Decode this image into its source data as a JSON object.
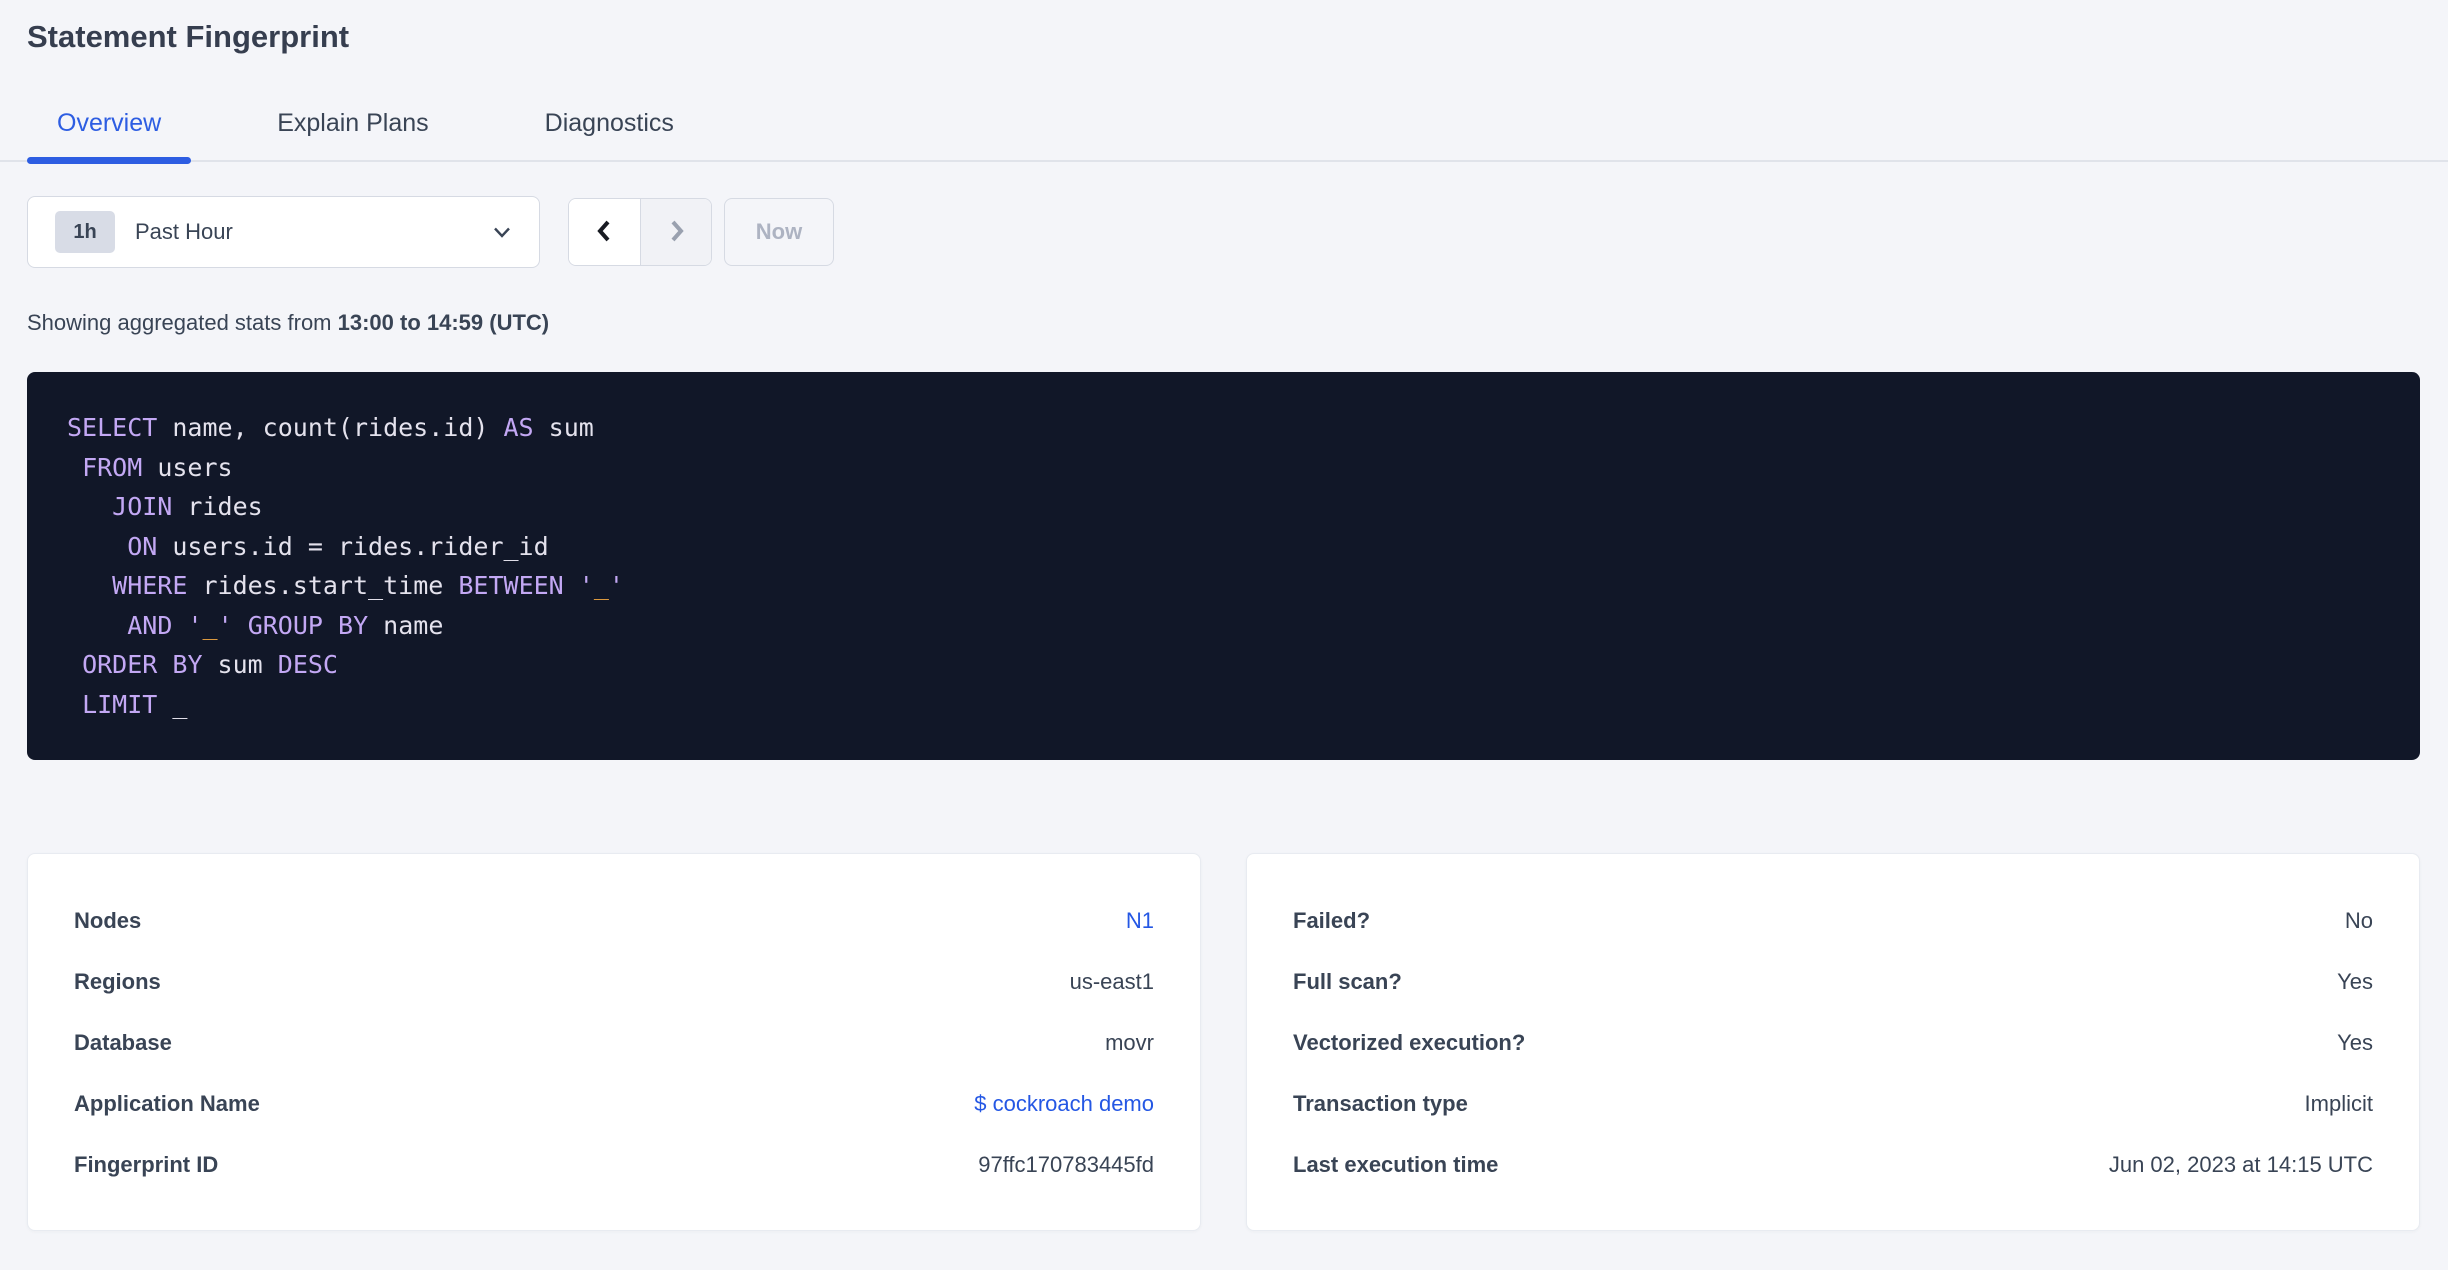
{
  "page": {
    "title": "Statement Fingerprint"
  },
  "tabs": [
    {
      "label": "Overview",
      "active": true
    },
    {
      "label": "Explain Plans",
      "active": false
    },
    {
      "label": "Diagnostics",
      "active": false
    }
  ],
  "time_picker": {
    "badge": "1h",
    "label": "Past Hour"
  },
  "nav": {
    "prev_enabled": true,
    "next_enabled": false,
    "now_label": "Now"
  },
  "stats_line": {
    "prefix": "Showing aggregated stats from ",
    "range": "13:00 to 14:59 (UTC)"
  },
  "sql": {
    "lines": [
      [
        {
          "t": "k",
          "v": "SELECT"
        },
        {
          "t": "p",
          "v": " name, count(rides.id) "
        },
        {
          "t": "k",
          "v": "AS"
        },
        {
          "t": "p",
          "v": " sum"
        }
      ],
      [
        {
          "t": "p",
          "v": " "
        },
        {
          "t": "k",
          "v": "FROM"
        },
        {
          "t": "p",
          "v": " users"
        }
      ],
      [
        {
          "t": "p",
          "v": "   "
        },
        {
          "t": "k",
          "v": "JOIN"
        },
        {
          "t": "p",
          "v": " rides"
        }
      ],
      [
        {
          "t": "p",
          "v": "    "
        },
        {
          "t": "k",
          "v": "ON"
        },
        {
          "t": "p",
          "v": " users.id = rides.rider_id"
        }
      ],
      [
        {
          "t": "p",
          "v": "   "
        },
        {
          "t": "k",
          "v": "WHERE"
        },
        {
          "t": "p",
          "v": " rides.start_time "
        },
        {
          "t": "k",
          "v": "BETWEEN"
        },
        {
          "t": "p",
          "v": " "
        },
        {
          "t": "q",
          "v": "'"
        },
        {
          "t": "s",
          "v": "_"
        },
        {
          "t": "q",
          "v": "'"
        }
      ],
      [
        {
          "t": "p",
          "v": "    "
        },
        {
          "t": "k",
          "v": "AND"
        },
        {
          "t": "p",
          "v": " "
        },
        {
          "t": "q",
          "v": "'"
        },
        {
          "t": "s",
          "v": "_"
        },
        {
          "t": "q",
          "v": "'"
        },
        {
          "t": "p",
          "v": " "
        },
        {
          "t": "k",
          "v": "GROUP"
        },
        {
          "t": "p",
          "v": " "
        },
        {
          "t": "k",
          "v": "BY"
        },
        {
          "t": "p",
          "v": " name"
        }
      ],
      [
        {
          "t": "p",
          "v": " "
        },
        {
          "t": "k",
          "v": "ORDER"
        },
        {
          "t": "p",
          "v": " "
        },
        {
          "t": "k",
          "v": "BY"
        },
        {
          "t": "p",
          "v": " sum "
        },
        {
          "t": "k",
          "v": "DESC"
        }
      ],
      [
        {
          "t": "p",
          "v": " "
        },
        {
          "t": "k",
          "v": "LIMIT"
        },
        {
          "t": "p",
          "v": " _"
        }
      ]
    ]
  },
  "cards": [
    {
      "rows": [
        {
          "label": "Nodes",
          "value": "N1",
          "link": true
        },
        {
          "label": "Regions",
          "value": "us-east1",
          "link": false
        },
        {
          "label": "Database",
          "value": "movr",
          "link": false
        },
        {
          "label": "Application Name",
          "value": "$ cockroach demo",
          "link": true
        },
        {
          "label": "Fingerprint ID",
          "value": "97ffc170783445fd",
          "link": false
        }
      ]
    },
    {
      "rows": [
        {
          "label": "Failed?",
          "value": "No",
          "link": false
        },
        {
          "label": "Full scan?",
          "value": "Yes",
          "link": false
        },
        {
          "label": "Vectorized execution?",
          "value": "Yes",
          "link": false
        },
        {
          "label": "Transaction type",
          "value": "Implicit",
          "link": false
        },
        {
          "label": "Last execution time",
          "value": "Jun 02, 2023 at 14:15 UTC",
          "link": false
        }
      ]
    }
  ],
  "colors": {
    "accent": "#2d5de2",
    "link": "#2457e4",
    "text": "#394455",
    "muted": "#adb3c2",
    "page_bg": "#f4f5f9",
    "code_bg": "#111728",
    "code_keyword": "#c3a8f4",
    "code_plain": "#e4e2ed",
    "code_string": "#e09c40",
    "badge_bg": "#d8dce6",
    "border": "#d6dae3",
    "divider": "#e0e3ea",
    "card_border": "#e8ebf1"
  }
}
